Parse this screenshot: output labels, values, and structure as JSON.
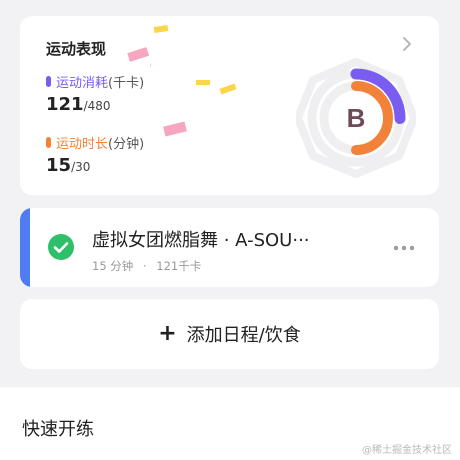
{
  "performance": {
    "title": "运动表现",
    "calories": {
      "label": "运动消耗",
      "unit": "(千卡)",
      "value": "121",
      "total": "/480",
      "fraction": 0.252,
      "color": "#7b5cf0"
    },
    "duration": {
      "label": "运动时长",
      "unit": "(分钟)",
      "value": "15",
      "total": "/30",
      "fraction": 0.5,
      "color": "#f2823a"
    },
    "grade": "B",
    "grade_color": "#6d4b5a"
  },
  "schedule": {
    "title": "虚拟女团燃脂舞 · A-SOU···",
    "duration": "15 分钟",
    "separator": "·",
    "calories": "121千卡",
    "accent_color": "#4f7cf0",
    "check_color": "#2fbf6a"
  },
  "add_button": {
    "label": "添加日程/饮食"
  },
  "quick_start": {
    "title": "快速开练"
  },
  "watermark": "@稀土掘金技术社区"
}
